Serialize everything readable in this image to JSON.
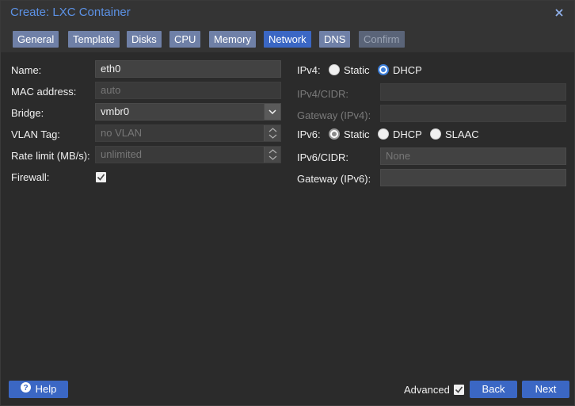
{
  "window": {
    "title": "Create: LXC Container"
  },
  "tabs": [
    {
      "label": "General"
    },
    {
      "label": "Template"
    },
    {
      "label": "Disks"
    },
    {
      "label": "CPU"
    },
    {
      "label": "Memory"
    },
    {
      "label": "Network"
    },
    {
      "label": "DNS"
    },
    {
      "label": "Confirm"
    }
  ],
  "form": {
    "name": {
      "label": "Name:",
      "value": "eth0"
    },
    "mac": {
      "label": "MAC address:",
      "placeholder": "auto"
    },
    "bridge": {
      "label": "Bridge:",
      "value": "vmbr0"
    },
    "vlan": {
      "label": "VLAN Tag:",
      "placeholder": "no VLAN"
    },
    "rate": {
      "label": "Rate limit (MB/s):",
      "placeholder": "unlimited"
    },
    "firewall": {
      "label": "Firewall:",
      "checked": true
    },
    "ipv4": {
      "label": "IPv4:",
      "static_label": "Static",
      "dhcp_label": "DHCP",
      "selected": "DHCP"
    },
    "ipv4_cidr": {
      "label": "IPv4/CIDR:",
      "value": ""
    },
    "gateway4": {
      "label": "Gateway (IPv4):",
      "value": ""
    },
    "ipv6": {
      "label": "IPv6:",
      "static_label": "Static",
      "dhcp_label": "DHCP",
      "slaac_label": "SLAAC",
      "selected": "Static"
    },
    "ipv6_cidr": {
      "label": "IPv6/CIDR:",
      "placeholder": "None"
    },
    "gateway6": {
      "label": "Gateway (IPv6):",
      "value": ""
    }
  },
  "footer": {
    "help_label": "Help",
    "advanced_label": "Advanced",
    "advanced_checked": true,
    "back_label": "Back",
    "next_label": "Next"
  },
  "colors": {
    "accent": "#3b67c4",
    "title": "#5c92e6",
    "background": "#2b2b2b"
  }
}
